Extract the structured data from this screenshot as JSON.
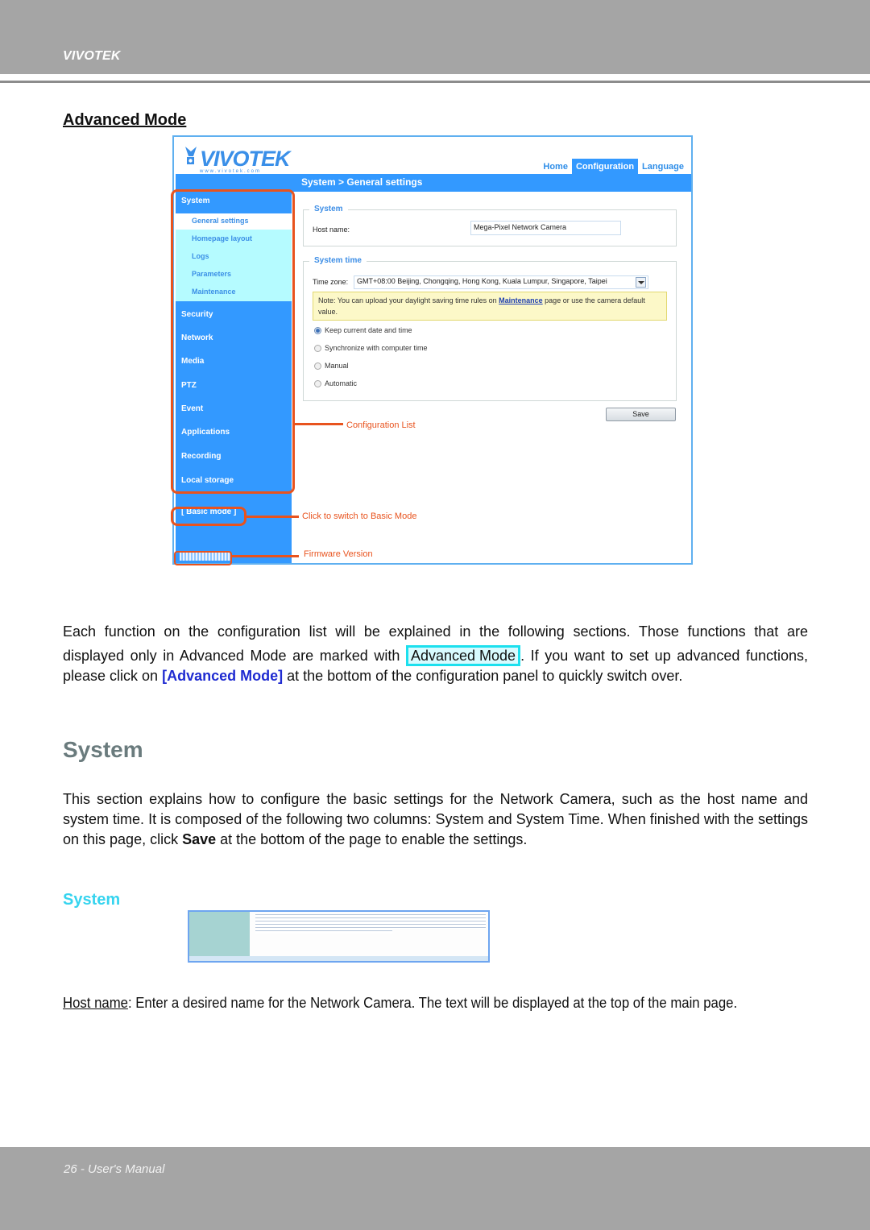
{
  "page": {
    "brand": "VIVOTEK",
    "footer": "26 - User's Manual"
  },
  "section_heading": "Advanced Mode",
  "screenshot": {
    "logo_text": "VIVOTEK",
    "logo_url": "www.vivotek.com",
    "nav": [
      {
        "label": "Home",
        "active": false
      },
      {
        "label": "Configuration",
        "active": true
      },
      {
        "label": "Language",
        "active": false
      }
    ],
    "breadcrumb": "System  > General settings",
    "sidebar": {
      "header": "System",
      "sub_items": [
        "General settings",
        "Homepage layout",
        "Logs",
        "Parameters",
        "Maintenance"
      ],
      "items": [
        "Security",
        "Network",
        "Media",
        "PTZ",
        "Event",
        "Applications",
        "Recording",
        "Local storage"
      ],
      "basic_mode": "[ Basic mode ]"
    },
    "system_box": {
      "legend": "System",
      "host_label": "Host name:",
      "host_value": "Mega-Pixel Network Camera"
    },
    "time_box": {
      "legend": "System time",
      "tz_label": "Time zone:",
      "tz_value": "GMT+08:00 Beijing, Chongqing, Hong Kong, Kuala Lumpur, Singapore, Taipei",
      "note_pre": "Note: You can upload your daylight saving time rules on ",
      "note_link": "Maintenance",
      "note_post": " page or use the camera default value.",
      "options": [
        {
          "label": "Keep current date and time",
          "selected": true
        },
        {
          "label": "Synchronize with computer time",
          "selected": false
        },
        {
          "label": "Manual",
          "selected": false
        },
        {
          "label": "Automatic",
          "selected": false
        }
      ]
    },
    "save_label": "Save"
  },
  "annotations": {
    "config_list": "Configuration List",
    "basic_mode": "Click to switch to Basic Mode",
    "firmware": "Firmware Version"
  },
  "paragraph1": {
    "line1": "Each function on the configuration list will be explained in the following sections. Those functions that are",
    "pre_badge": "displayed only in Advanced Mode are marked with ",
    "badge": "Advanced Mode",
    "post_badge": ". If you want to set up advanced functions, please click on ",
    "link": "[Advanced Mode]",
    "tail": " at the bottom of the configuration panel to quickly switch over."
  },
  "system_heading": "System",
  "paragraph2": {
    "pre": "This section explains how to configure the basic settings for the Network Camera, such as the host name and system time. It is composed of the following two columns: System and System Time. When finished with the settings on this page, click ",
    "bold": "Save",
    "post": " at the bottom of the page to enable the settings."
  },
  "subheading": "System",
  "host_para": {
    "term": "Host name",
    "text": ": Enter a desired name for the Network Camera. The text will be displayed at the top of the main page."
  }
}
